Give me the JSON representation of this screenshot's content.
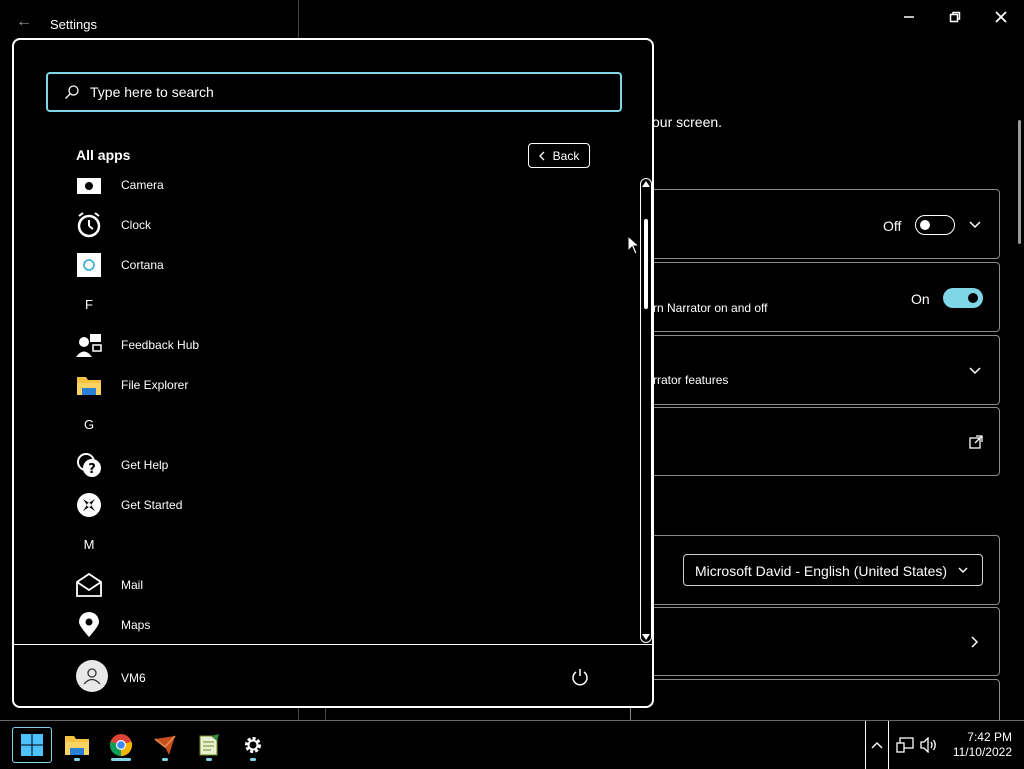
{
  "settings_window": {
    "title": "Settings",
    "description_fragment": "our screen.",
    "narrator_shortcut_fragment": "rn Narrator on and off",
    "narrator_features_fragment": "rrator features",
    "toggle1_state": "Off",
    "toggle2_state": "On",
    "voice_select_value": "Microsoft David - English (United States)"
  },
  "start_menu": {
    "search_placeholder": "Type here to search",
    "section_title": "All apps",
    "back_label": "Back",
    "apps": [
      {
        "type": "app",
        "label": "Camera",
        "icon": "camera-icon"
      },
      {
        "type": "app",
        "label": "Clock",
        "icon": "clock-icon"
      },
      {
        "type": "app",
        "label": "Cortana",
        "icon": "cortana-icon"
      },
      {
        "type": "letter",
        "label": "F"
      },
      {
        "type": "app",
        "label": "Feedback Hub",
        "icon": "feedback-hub-icon"
      },
      {
        "type": "app",
        "label": "File Explorer",
        "icon": "folder-icon"
      },
      {
        "type": "letter",
        "label": "G"
      },
      {
        "type": "app",
        "label": "Get Help",
        "icon": "get-help-icon"
      },
      {
        "type": "app",
        "label": "Get Started",
        "icon": "get-started-icon"
      },
      {
        "type": "letter",
        "label": "M"
      },
      {
        "type": "app",
        "label": "Mail",
        "icon": "mail-icon"
      },
      {
        "type": "app",
        "label": "Maps",
        "icon": "maps-icon"
      }
    ],
    "user_name": "VM6"
  },
  "taskbar": {
    "apps": [
      "windows-start-icon",
      "file-explorer-icon",
      "chrome-icon",
      "app-icon",
      "notepad-icon",
      "settings-gear-icon"
    ],
    "time": "7:42 PM",
    "date": "11/10/2022"
  },
  "colors": {
    "accent": "#7fd6e6",
    "background": "#000000",
    "foreground": "#ffffff"
  }
}
